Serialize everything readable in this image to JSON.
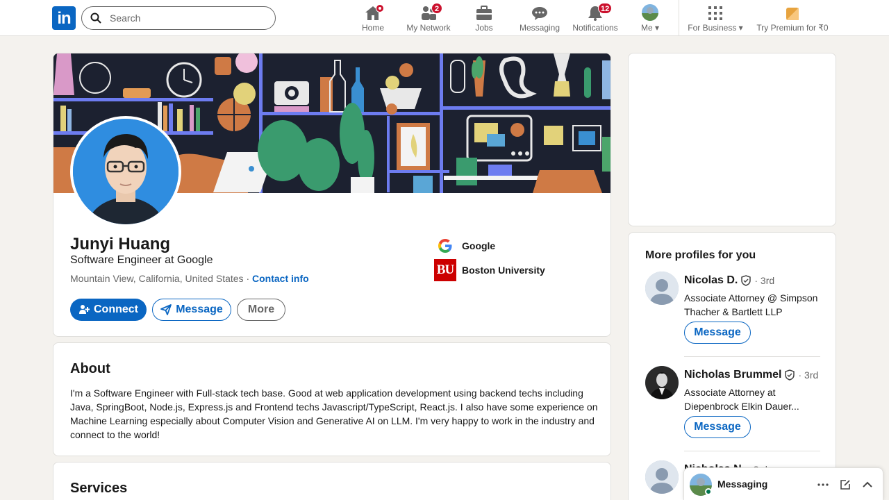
{
  "nav": {
    "logo": "in",
    "search_placeholder": "Search",
    "items": [
      {
        "label": "Home",
        "badge": ""
      },
      {
        "label": "My Network",
        "badge": "2"
      },
      {
        "label": "Jobs",
        "badge": ""
      },
      {
        "label": "Messaging",
        "badge": ""
      },
      {
        "label": "Notifications",
        "badge": "12"
      },
      {
        "label": "Me",
        "badge": ""
      },
      {
        "label": "For Business",
        "badge": ""
      },
      {
        "label": "Try Premium for ₹0",
        "badge": ""
      }
    ]
  },
  "profile": {
    "name": "Junyi Huang",
    "headline": "Software Engineer at Google",
    "location": "Mountain View, California, United States",
    "separator": "·",
    "contact_info": "Contact info",
    "buttons": {
      "connect": "Connect",
      "message": "Message",
      "more": "More"
    },
    "orgs": [
      {
        "name": "Google",
        "logo": "google-logo"
      },
      {
        "name": "Boston University",
        "logo": "bu-logo",
        "logo_text": "BU"
      }
    ]
  },
  "about": {
    "title": "About",
    "text": "I'm a Software Engineer with Full-stack tech base. Good at web application development using backend techs including Java, SpringBoot, Node.js, Express.js and Frontend techs Javascript/TypeScript, React.js. I also have some experience on Machine Learning especially about Computer Vision and Generative AI on LLM. I'm very happy to work in the industry and connect to the world!"
  },
  "services": {
    "title": "Services"
  },
  "right_panel": {
    "title": "More profiles for you",
    "people": [
      {
        "name": "Nicolas D.",
        "degree": "· 3rd",
        "title": "Associate Attorney @ Simpson Thacher & Bartlett LLP",
        "button": "Message"
      },
      {
        "name": "Nicholas Brummel",
        "degree": "· 3rd",
        "title": "Associate Attorney at Diepenbrock Elkin Dauer...",
        "button": "Message"
      },
      {
        "name": "Nicholas N.",
        "degree": "· 3rd",
        "title": "",
        "button": ""
      }
    ]
  },
  "messaging": {
    "label": "Messaging"
  },
  "colors": {
    "brand": "#0a66c2",
    "badge": "#cb112d",
    "online": "#01754f"
  }
}
